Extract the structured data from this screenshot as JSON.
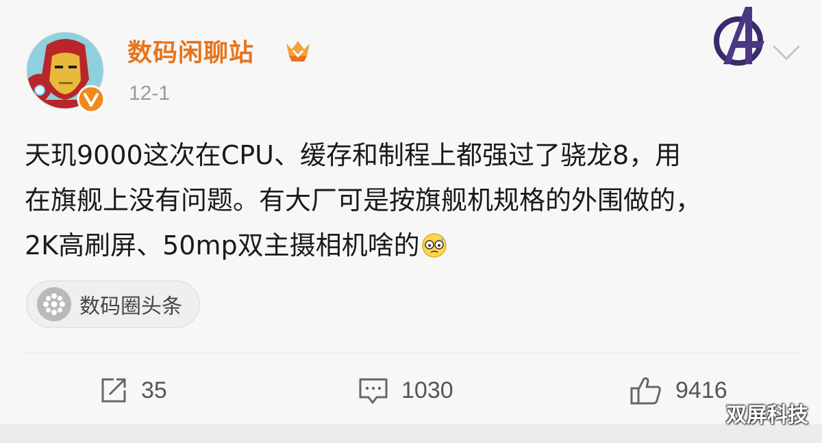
{
  "post": {
    "username": "数码闲聊站",
    "timestamp": "12-1",
    "content_lines": [
      "天玑9000这次在CPU、缓存和制程上都强过了骁龙8，用",
      "在旗舰上没有问题。有大厂可是按旗舰机规格的外围做的，",
      "2K高刷屏、50mp双主摄相机啥的"
    ],
    "emoji": "sweat-smile-emoji",
    "topic": "数码圈头条"
  },
  "actions": {
    "repost_count": "35",
    "comment_count": "1030",
    "like_count": "9416"
  },
  "icons": {
    "avatar": "iron-man-avatar",
    "verified": "verified-v-badge",
    "member": "member-crown-badge",
    "brand": "avengers-logo",
    "more": "chevron-down-icon",
    "topic": "topic-dots-icon",
    "repost": "repost-icon",
    "comment": "comment-icon",
    "like": "thumbs-up-icon"
  },
  "colors": {
    "username": "#e8731b",
    "verified": "#f08a1c",
    "text": "#1a1a1a",
    "muted": "#9a9a9a"
  },
  "watermark": "双屏科技"
}
